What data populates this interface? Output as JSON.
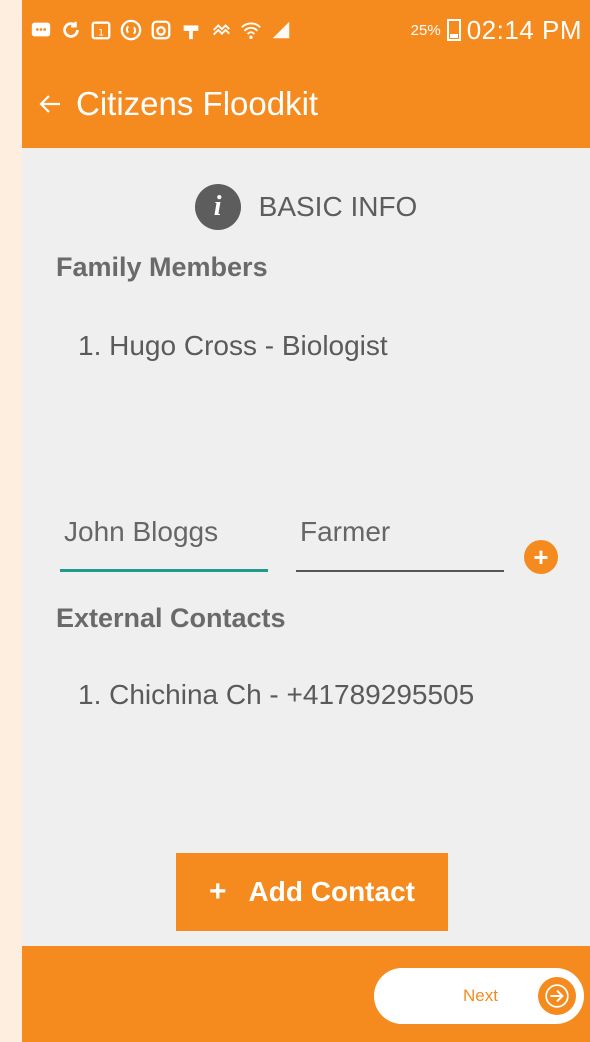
{
  "status_bar": {
    "icons": [
      "message-icon",
      "sync-icon",
      "calendar-icon",
      "shazam-icon",
      "instagram-icon",
      "usb-icon",
      "nfc-icon",
      "wifi-icon",
      "signal-icon"
    ],
    "battery": "25%",
    "time": "02:14 PM"
  },
  "app_bar": {
    "title": "Citizens Floodkit"
  },
  "section": {
    "title": "BASIC INFO"
  },
  "family": {
    "label": "Family Members",
    "items": [
      "1. Hugo Cross - Biologist"
    ],
    "name_value": "John Bloggs",
    "role_value": "Farmer"
  },
  "contacts": {
    "label": "External Contacts",
    "items": [
      "1. Chichina Ch - +41789295505"
    ],
    "add_button": "Add Contact"
  },
  "footer": {
    "next_label": "Next"
  },
  "colors": {
    "accent": "#f58b1f",
    "background": "#efefef",
    "input_underline_active": "#1f9a8f"
  }
}
